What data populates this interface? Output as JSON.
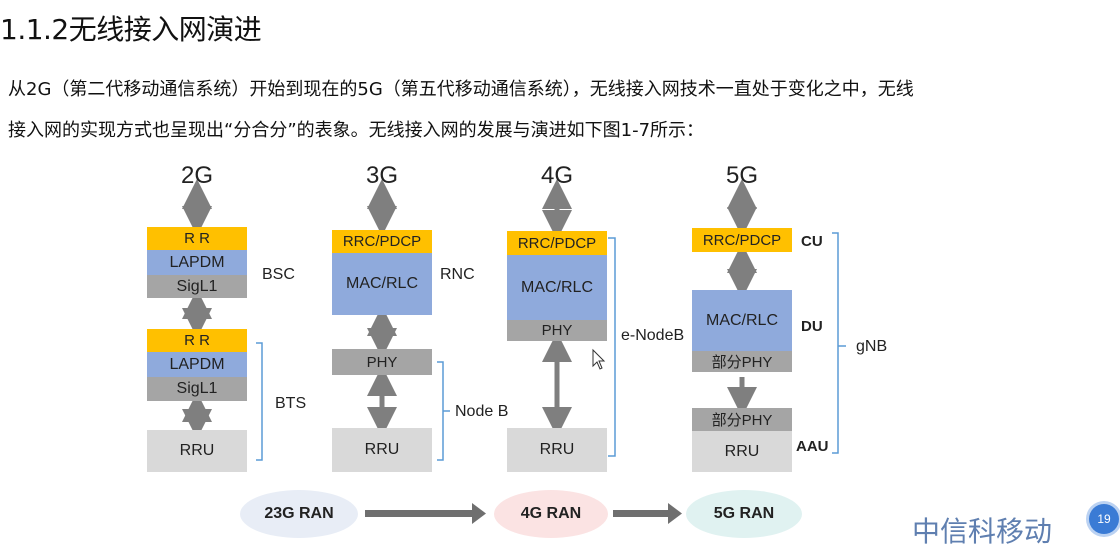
{
  "heading": "1.1.2无线接入网演进",
  "paragraph": {
    "line1": "从2G（第二代移动通信系统）开始到现在的5G（第五代移动通信系统），无线接入网技术一直处于变化之中，无线",
    "line2": "接入网的实现方式也呈现出“分合分”的表象。无线接入网的发展与演进如下图1-7所示："
  },
  "diagram": {
    "generations": [
      "2G",
      "3G",
      "4G",
      "5G"
    ],
    "g2": {
      "bsc_blocks": [
        "R R",
        "LAPDM",
        "SigL1"
      ],
      "bts_blocks": [
        "R R",
        "LAPDM",
        "SigL1"
      ],
      "rru": "RRU",
      "bsc_label": "BSC",
      "bts_label": "BTS"
    },
    "g3": {
      "top": "RRC/PDCP",
      "mid": "MAC/RLC",
      "phy": "PHY",
      "rru": "RRU",
      "rnc_label": "RNC",
      "nodeb_label": "Node B"
    },
    "g4": {
      "top": "RRC/PDCP",
      "mid": "MAC/RLC",
      "phy": "PHY",
      "rru": "RRU",
      "enodeb_label": "e-NodeB"
    },
    "g5": {
      "top": "RRC/PDCP",
      "mid": "MAC/RLC",
      "phy_part1": "部分PHY",
      "phy_part2": "部分PHY",
      "rru": "RRU",
      "cu_label": "CU",
      "du_label": "DU",
      "aau_label": "AAU",
      "gnb_label": "gNB"
    },
    "ran": [
      "23G RAN",
      "4G RAN",
      "5G RAN"
    ]
  },
  "footer": {
    "brand": "中信科移动",
    "page_badge": "19"
  },
  "colors": {
    "yellow": "#FFC000",
    "blue": "#8FAADC",
    "gray": "#A5A5A5",
    "light_gray": "#D9D9D9",
    "bracket": "#5B9BD5"
  }
}
